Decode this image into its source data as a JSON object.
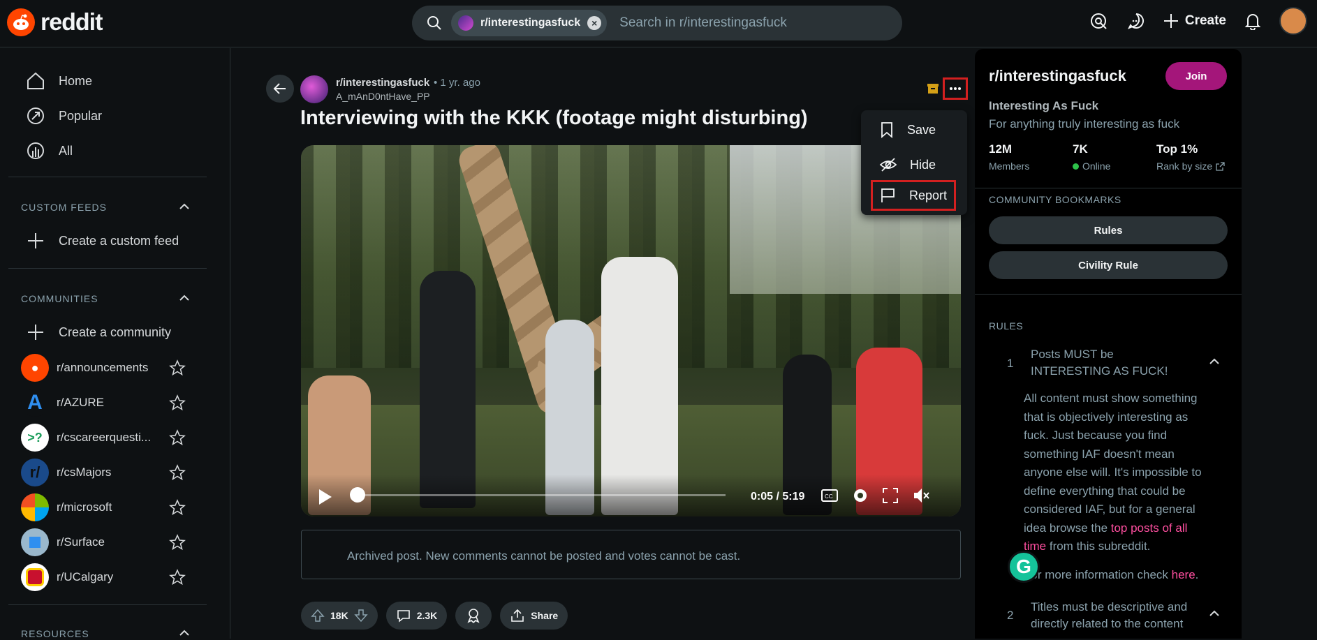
{
  "header": {
    "logo_text": "reddit",
    "search_chip": "r/interestingasfuck",
    "search_placeholder": "Search in r/interestingasfuck",
    "create_label": "Create"
  },
  "sidebar": {
    "nav": [
      {
        "label": "Home",
        "icon": "home-icon"
      },
      {
        "label": "Popular",
        "icon": "popular-icon"
      },
      {
        "label": "All",
        "icon": "all-icon"
      }
    ],
    "custom_feeds_title": "CUSTOM FEEDS",
    "create_custom_feed": "Create a custom feed",
    "communities_title": "COMMUNITIES",
    "create_community": "Create a community",
    "communities": [
      {
        "label": "r/announcements",
        "color": "#ff4500"
      },
      {
        "label": "r/AZURE",
        "color": "#0e1113"
      },
      {
        "label": "r/cscareerquesti...",
        "color": "#ffffff"
      },
      {
        "label": "r/csMajors",
        "color": "#1a4a8a"
      },
      {
        "label": "r/microsoft",
        "color": "#ffffff"
      },
      {
        "label": "r/Surface",
        "color": "#5aa0d8"
      },
      {
        "label": "r/UCalgary",
        "color": "#ffffff"
      }
    ],
    "resources_title": "RESOURCES"
  },
  "post": {
    "subreddit": "r/interestingasfuck",
    "time": "• 1 yr. ago",
    "user": "A_mAnD0ntHave_PP",
    "title": "Interviewing with the KKK (footage might disturbing)",
    "video_time": "0:05 / 5:19",
    "archived_notice": "Archived post. New comments cannot be posted and votes cannot be cast.",
    "votes": "18K",
    "comments": "2.3K",
    "share_label": "Share"
  },
  "menu": {
    "save": "Save",
    "hide": "Hide",
    "report": "Report"
  },
  "community": {
    "title": "r/interestingasfuck",
    "join_label": "Join",
    "name": "Interesting As Fuck",
    "description": "For anything truly interesting as fuck",
    "members_value": "12M",
    "members_label": "Members",
    "online_value": "7K",
    "online_label": "Online",
    "rank_value": "Top 1%",
    "rank_label": "Rank by size",
    "bookmarks_title": "COMMUNITY BOOKMARKS",
    "bookmark_rules": "Rules",
    "bookmark_civility": "Civility Rule",
    "rules_title": "RULES",
    "rule1_num": "1",
    "rule1_title": "Posts MUST be INTERESTING AS FUCK!",
    "rule1_body_a": "All content must show something that is objectively interesting as fuck. Just because you find something IAF doesn't mean anyone else will. It's impossible to define everything that could be considered IAF, but for a general idea browse the ",
    "rule1_link": "top posts of all time",
    "rule1_body_b": " from this subreddit.",
    "rule1_more_a": "For more information check ",
    "rule1_more_link": "here",
    "rule1_more_b": ".",
    "rule2_num": "2",
    "rule2_title": "Titles must be descriptive and directly related to the content"
  }
}
